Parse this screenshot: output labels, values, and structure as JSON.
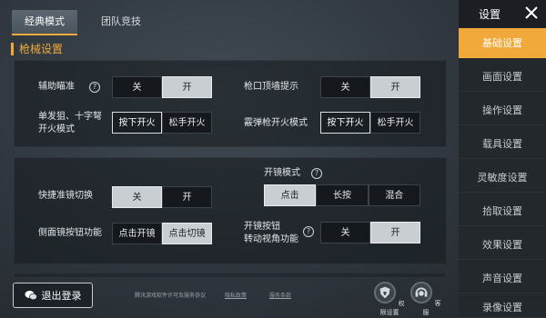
{
  "modes": {
    "tab_classic": "经典模式",
    "tab_team": "团队竞技"
  },
  "section_title": "枪械设置",
  "panel1": {
    "aim_assist": {
      "label": "辅助瞄准",
      "options": [
        "关",
        "开"
      ],
      "selected": "开"
    },
    "muzzle_hint": {
      "label": "枪口顶墙提示",
      "options": [
        "关",
        "开"
      ],
      "selected": "开"
    },
    "sniper_fire": {
      "label_line1": "单发狙、十字弩",
      "label_line2": "开火模式",
      "options": [
        "按下开火",
        "松手开火"
      ],
      "selected": "按下开火"
    },
    "shotgun_fire": {
      "label": "霰弹枪开火模式",
      "options": [
        "按下开火",
        "松手开火"
      ],
      "selected": "按下开火"
    }
  },
  "panel2": {
    "scope_mode": {
      "label": "开镜模式",
      "options": [
        "点击",
        "长按",
        "混合"
      ],
      "selected": "点击"
    },
    "quick_switch": {
      "label": "快捷准镜切换",
      "options": [
        "关",
        "开"
      ],
      "selected": "关"
    },
    "side_button": {
      "label": "侧面镜按钮功能",
      "options": [
        "点击开镜",
        "点击切镜"
      ],
      "selected": "点击切镜"
    },
    "scope_turn": {
      "label_line1": "开镜按钮",
      "label_line2": "转动视角功能",
      "options": [
        "关",
        "开"
      ],
      "selected": "开"
    }
  },
  "sidebar": {
    "title": "设置",
    "items": [
      "基础设置",
      "画面设置",
      "操作设置",
      "载具设置",
      "灵敏度设置",
      "拾取设置",
      "效果设置",
      "声音设置",
      "录像设置"
    ],
    "active": "基础设置"
  },
  "bottom": {
    "logout_label": "退出登录",
    "link1": "腾讯游戏软件许可及服务协议",
    "link2": "隐私政策",
    "link3": "服务条款",
    "permissions_label": "权限设置",
    "support_label": "客服"
  },
  "colors": {
    "accent": "#f0a93a",
    "sidebar_bg": "#23282d"
  }
}
